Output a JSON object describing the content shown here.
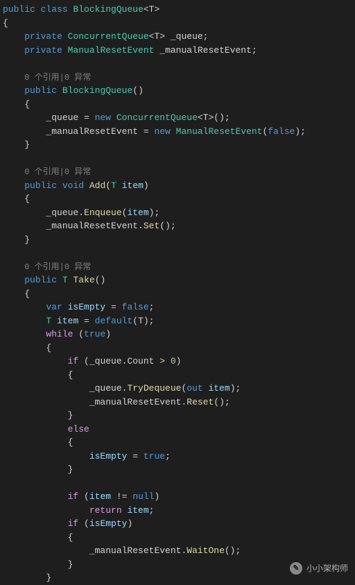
{
  "code": {
    "l1_public": "public",
    "l1_class": "class",
    "l1_name": "BlockingQueue",
    "l1_generic": "<T>",
    "l2_brace": "{",
    "l3_private": "private",
    "l3_type": "ConcurrentQueue",
    "l3_generic": "<T>",
    "l3_field": " _queue;",
    "l4_private": "private",
    "l4_type": "ManualResetEvent",
    "l4_field": " _manualResetEvent;",
    "l6_codelens": "0 个引用|0 异常",
    "l7_public": "public",
    "l7_ctor": "BlockingQueue",
    "l7_paren": "()",
    "l8_brace": "{",
    "l9_assign": "_queue = ",
    "l9_new": "new",
    "l9_type": " ConcurrentQueue",
    "l9_rest": "<T>();",
    "l10_assign": "_manualResetEvent = ",
    "l10_new": "new",
    "l10_type": " ManualResetEvent",
    "l10_open": "(",
    "l10_false": "false",
    "l10_close": ");",
    "l11_brace": "}",
    "l13_codelens": "0 个引用|0 异常",
    "l14_public": "public",
    "l14_void": "void",
    "l14_method": "Add",
    "l14_open": "(",
    "l14_ptype": "T",
    "l14_pname": " item",
    "l14_close": ")",
    "l15_brace": "{",
    "l16_q": "_queue.",
    "l16_enq": "Enqueue",
    "l16_open": "(",
    "l16_item": "item",
    "l16_close": ");",
    "l17_m": "_manualResetEvent.",
    "l17_set": "Set",
    "l17_rest": "();",
    "l18_brace": "}",
    "l20_codelens": "0 个引用|0 异常",
    "l21_public": "public",
    "l21_t": "T",
    "l21_method": "Take",
    "l21_paren": "()",
    "l22_brace": "{",
    "l23_var": "var",
    "l23_name": " isEmpty",
    "l23_eq": " = ",
    "l23_false": "false",
    "l23_semi": ";",
    "l24_t": "T",
    "l24_name": " item",
    "l24_eq": " = ",
    "l24_default": "default",
    "l24_rest": "(T);",
    "l25_while": "while",
    "l25_open": " (",
    "l25_true": "true",
    "l25_close": ")",
    "l26_brace": "{",
    "l27_if": "if",
    "l27_cond": " (_queue.Count > ",
    "l27_zero": "0",
    "l27_close": ")",
    "l28_brace": "{",
    "l29_q": "_queue.",
    "l29_try": "TryDequeue",
    "l29_open": "(",
    "l29_out": "out",
    "l29_item": " item",
    "l29_close": ");",
    "l30_m": "_manualResetEvent.",
    "l30_reset": "Reset",
    "l30_rest": "();",
    "l31_brace": "}",
    "l32_else": "else",
    "l33_brace": "{",
    "l34_name": "isEmpty",
    "l34_eq": " = ",
    "l34_true": "true",
    "l34_semi": ";",
    "l35_brace": "}",
    "l37_if": "if",
    "l37_open": " (",
    "l37_item": "item",
    "l37_neq": " != ",
    "l37_null": "null",
    "l37_close": ")",
    "l38_return": "return",
    "l38_item": " item",
    "l38_semi": ";",
    "l39_if": "if",
    "l39_open": " (",
    "l39_name": "isEmpty",
    "l39_close": ")",
    "l40_brace": "{",
    "l41_m": "_manualResetEvent.",
    "l41_wait": "WaitOne",
    "l41_rest": "();",
    "l42_brace": "}",
    "l43_brace": "}"
  },
  "watermark": {
    "text": "小小架构师",
    "icon": "✎"
  }
}
